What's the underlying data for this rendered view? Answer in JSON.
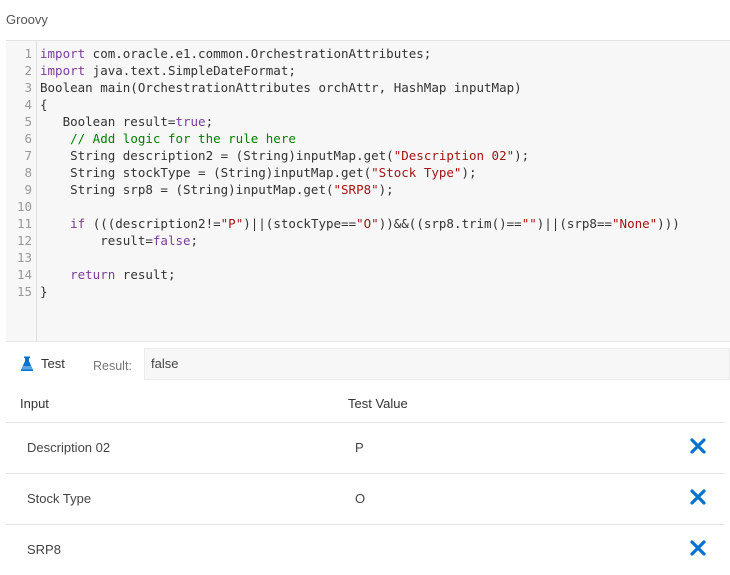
{
  "title": "Groovy",
  "editor": {
    "lines": [
      {
        "n": "1",
        "parts": [
          {
            "t": "import",
            "c": "kw"
          },
          {
            "t": " com.oracle.e1.common.OrchestrationAttributes;"
          }
        ]
      },
      {
        "n": "2",
        "parts": [
          {
            "t": "import",
            "c": "kw"
          },
          {
            "t": " java.text.SimpleDateFormat;"
          }
        ]
      },
      {
        "n": "3",
        "parts": [
          {
            "t": "Boolean main(OrchestrationAttributes orchAttr, HashMap inputMap)"
          }
        ]
      },
      {
        "n": "4",
        "parts": [
          {
            "t": "{"
          }
        ]
      },
      {
        "n": "5",
        "parts": [
          {
            "t": "   Boolean result="
          },
          {
            "t": "true",
            "c": "bool"
          },
          {
            "t": ";"
          }
        ]
      },
      {
        "n": "6",
        "parts": [
          {
            "t": "    "
          },
          {
            "t": "// Add logic for the rule here",
            "c": "cmt"
          }
        ]
      },
      {
        "n": "7",
        "parts": [
          {
            "t": "    String description2 = (String)inputMap.get("
          },
          {
            "t": "\"Description 02\"",
            "c": "str"
          },
          {
            "t": ");"
          }
        ]
      },
      {
        "n": "8",
        "parts": [
          {
            "t": "    String stockType = (String)inputMap.get("
          },
          {
            "t": "\"Stock Type\"",
            "c": "str"
          },
          {
            "t": ");"
          }
        ]
      },
      {
        "n": "9",
        "parts": [
          {
            "t": "    String srp8 = (String)inputMap.get("
          },
          {
            "t": "\"SRP8\"",
            "c": "str"
          },
          {
            "t": ");"
          }
        ]
      },
      {
        "n": "10",
        "parts": [
          {
            "t": ""
          }
        ]
      },
      {
        "n": "11",
        "parts": [
          {
            "t": "    "
          },
          {
            "t": "if",
            "c": "kw"
          },
          {
            "t": " (((description2!="
          },
          {
            "t": "\"P\"",
            "c": "str"
          },
          {
            "t": ")||(stockType=="
          },
          {
            "t": "\"O\"",
            "c": "str"
          },
          {
            "t": "))&&((srp8.trim()=="
          },
          {
            "t": "\"\"",
            "c": "str"
          },
          {
            "t": ")||(srp8=="
          },
          {
            "t": "\"None\"",
            "c": "str"
          },
          {
            "t": ")))"
          }
        ]
      },
      {
        "n": "12",
        "parts": [
          {
            "t": "        result="
          },
          {
            "t": "false",
            "c": "bool"
          },
          {
            "t": ";"
          }
        ]
      },
      {
        "n": "13",
        "parts": [
          {
            "t": ""
          }
        ]
      },
      {
        "n": "14",
        "parts": [
          {
            "t": "    "
          },
          {
            "t": "return",
            "c": "kw"
          },
          {
            "t": " result;"
          }
        ]
      },
      {
        "n": "15",
        "parts": [
          {
            "t": "}"
          }
        ]
      }
    ]
  },
  "test": {
    "tab_label": "Test",
    "result_label": "Result:",
    "result_value": "false"
  },
  "table": {
    "col_input": "Input",
    "col_value": "Test Value",
    "rows": [
      {
        "name": "Description 02",
        "value": "P"
      },
      {
        "name": "Stock Type",
        "value": "O"
      },
      {
        "name": "SRP8",
        "value": ""
      }
    ]
  },
  "colors": {
    "accent": "#0572ce",
    "keyword": "#7a3e9d",
    "string": "#a31515",
    "comment": "#008000"
  },
  "icons": {
    "test": "flask-icon",
    "delete": "close-icon"
  }
}
